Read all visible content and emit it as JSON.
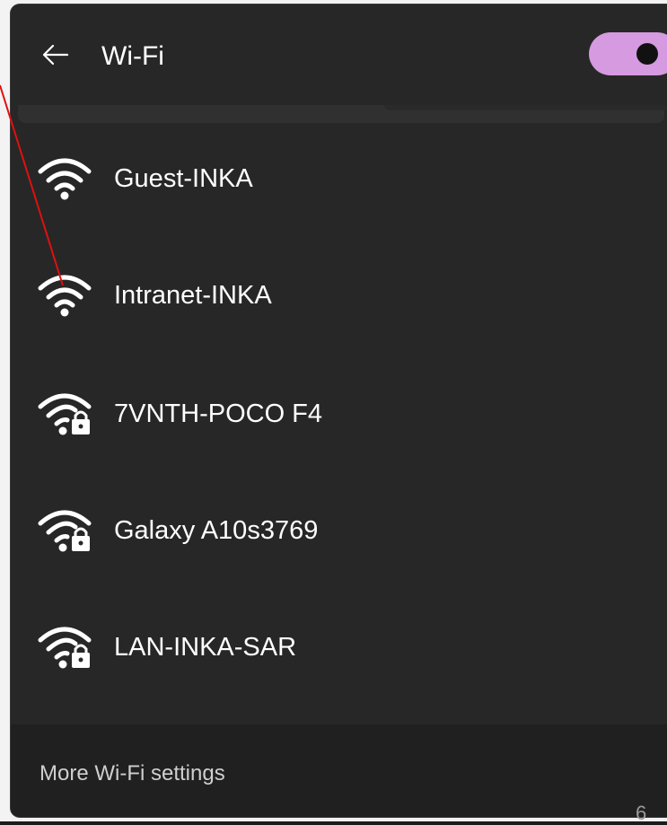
{
  "header": {
    "title": "Wi-Fi",
    "back_icon": "arrow-left-icon",
    "toggle_state": "on",
    "toggle_color": "#d59ae0"
  },
  "networks": [
    {
      "name": "Guest-INKA",
      "secured": false,
      "icon": "wifi-signal-icon"
    },
    {
      "name": "Intranet-INKA",
      "secured": false,
      "icon": "wifi-signal-icon"
    },
    {
      "name": "7VNTH-POCO F4",
      "secured": true,
      "icon": "wifi-secured-icon"
    },
    {
      "name": "Galaxy A10s3769",
      "secured": true,
      "icon": "wifi-secured-icon"
    },
    {
      "name": "LAN-INKA-SAR",
      "secured": true,
      "icon": "wifi-secured-icon"
    }
  ],
  "footer": {
    "more_settings_label": "More Wi-Fi settings"
  },
  "page_number": "6",
  "colors": {
    "panel_bg": "#272727",
    "footer_bg": "#202020",
    "annotation_line": "#e01010"
  }
}
